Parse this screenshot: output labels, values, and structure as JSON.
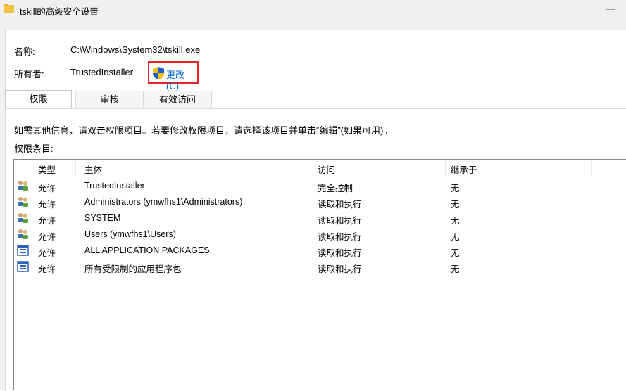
{
  "window": {
    "title": "tskill的高级安全设置",
    "minimize_glyph": "—"
  },
  "info": {
    "name_label": "名称:",
    "name_value": "C:\\Windows\\System32\\tskill.exe",
    "owner_label": "所有者:",
    "owner_value": "TrustedInstaller",
    "change_label": "更改(C)"
  },
  "tabs": [
    {
      "label": "权限",
      "active": true
    },
    {
      "label": "审核",
      "active": false
    },
    {
      "label": "有效访问",
      "active": false
    }
  ],
  "instructions": "如需其他信息，请双击权限项目。若要修改权限项目，请选择该项目并单击“编辑”(如果可用)。",
  "entries_label": "权限条目:",
  "table": {
    "headers": [
      "类型",
      "主体",
      "访问",
      "继承于"
    ],
    "rows": [
      {
        "icon": "user-group-icon",
        "type": "允许",
        "principal": "TrustedInstaller",
        "access": "完全控制",
        "inherited": "无"
      },
      {
        "icon": "user-group-icon",
        "type": "允许",
        "principal": "Administrators (ymwfhs1\\Administrators)",
        "access": "读取和执行",
        "inherited": "无"
      },
      {
        "icon": "user-group-icon",
        "type": "允许",
        "principal": "SYSTEM",
        "access": "读取和执行",
        "inherited": "无"
      },
      {
        "icon": "user-group-icon",
        "type": "允许",
        "principal": "Users (ymwfhs1\\Users)",
        "access": "读取和执行",
        "inherited": "无"
      },
      {
        "icon": "app-package-icon",
        "type": "允许",
        "principal": "ALL APPLICATION PACKAGES",
        "access": "读取和执行",
        "inherited": "无"
      },
      {
        "icon": "app-package-icon",
        "type": "允许",
        "principal": "所有受限制的应用程序包",
        "access": "读取和执行",
        "inherited": "无"
      }
    ]
  },
  "colors": {
    "link": "#0066cc",
    "highlight_box": "#e62626",
    "folder": "#f5c242"
  }
}
